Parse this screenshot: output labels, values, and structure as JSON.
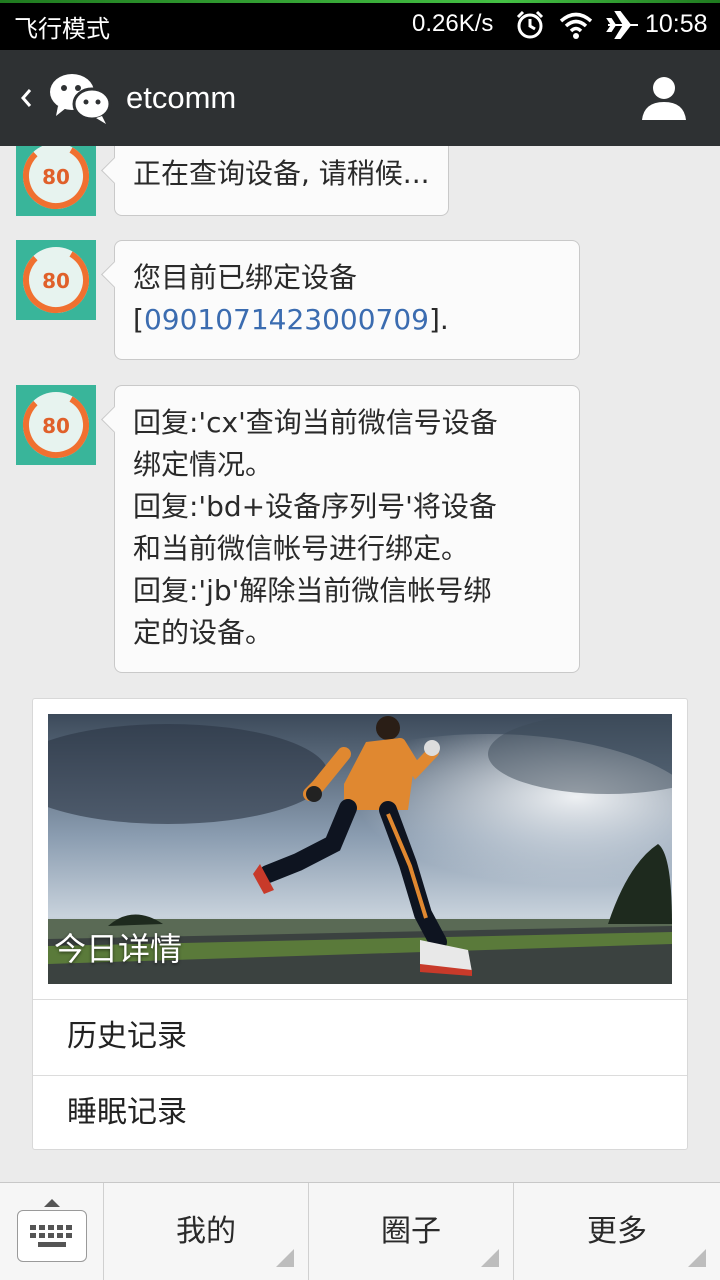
{
  "status_bar": {
    "mode": "飞行模式",
    "net_speed": "0.26K/s",
    "time": "10:58",
    "icons": [
      "alarm-icon",
      "wifi-icon",
      "airplane-icon"
    ]
  },
  "header": {
    "back_icon": "chevron-left-icon",
    "logo_icon": "wechat-logo-icon",
    "title": "etcomm",
    "profile_icon": "person-icon"
  },
  "avatar": {
    "score": "80"
  },
  "messages": [
    {
      "lines": [
        "正在查询设备, 请稍候..."
      ]
    },
    {
      "lines": [
        "您目前已绑定设备"
      ],
      "link_prefix": "[",
      "link": "0901071423000709",
      "link_suffix": "]."
    },
    {
      "lines": [
        "回复:'cx'查询当前微信号设备",
        "绑定情况。",
        "回复:'bd+设备序列号'将设备",
        "和当前微信帐号进行绑定。",
        "回复:'jb'解除当前微信帐号绑",
        "定的设备。"
      ]
    }
  ],
  "card": {
    "hero_caption": "今日详情",
    "rows": [
      "历史记录",
      "睡眠记录"
    ]
  },
  "menu": {
    "keyboard_icon": "keyboard-icon",
    "items": [
      "我的",
      "圈子",
      "更多"
    ]
  },
  "colors": {
    "header_bg": "#2e3133",
    "avatar_bg": "#39b59a",
    "link": "#3b6cb0",
    "ring": "#f07030"
  }
}
